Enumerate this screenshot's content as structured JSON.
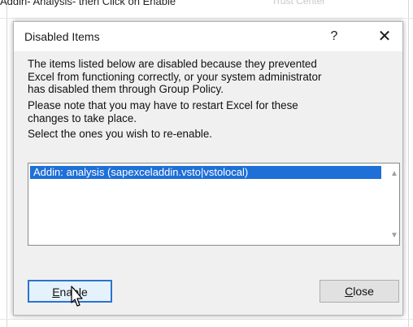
{
  "background": {
    "caption": "Addin- Analysis- then Click on Enable",
    "caption_right": "Trust Center"
  },
  "dialog": {
    "title": "Disabled Items",
    "help_label": "?",
    "close_label": "✕",
    "paragraph1": "The items listed below are disabled because they prevented\nExcel from functioning correctly, or your system administrator\nhas disabled them through Group Policy.",
    "paragraph2": "Please note that you may have to restart Excel for these\nchanges to take place.",
    "paragraph3": "Select the ones you wish to re-enable.",
    "items": [
      {
        "label": "Addin: analysis (sapexceladdin.vsto|vstolocal)",
        "selected": true
      }
    ],
    "enable_button": {
      "mnemonic": "E",
      "rest": "nable"
    },
    "close_button": {
      "mnemonic": "C",
      "rest": "lose"
    }
  },
  "colors": {
    "selection": "#1e6fd8",
    "default_button_border": "#2b73d1",
    "dialog_bg": "#f0f0f0"
  },
  "icons": [
    "scroll-up-arrow-icon",
    "scroll-down-arrow-icon",
    "mouse-pointer-icon"
  ]
}
